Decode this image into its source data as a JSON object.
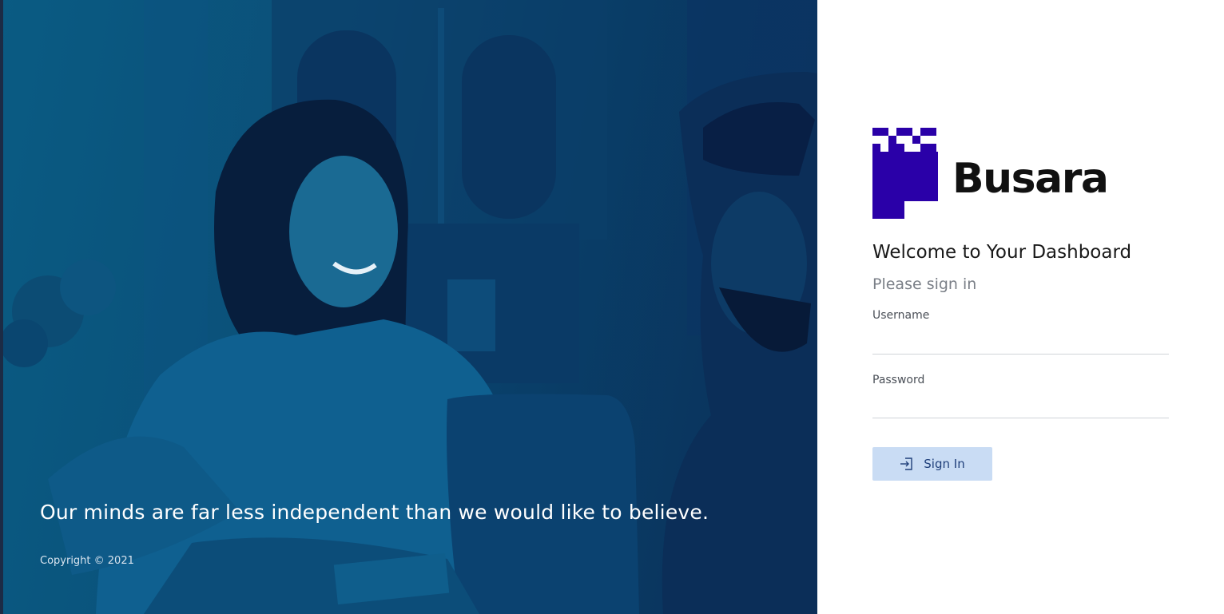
{
  "hero": {
    "quote": "Our minds are far less independent than we would like to believe.",
    "copyright": "Copyright © 2021",
    "image_description_icon": "photo-people-talking"
  },
  "brand": {
    "name": "Busara",
    "logo_color": "#2a00a8"
  },
  "login": {
    "title": "Welcome to Your Dashboard",
    "subtitle": "Please sign in",
    "username_label": "Username",
    "username_value": "",
    "password_label": "Password",
    "password_value": "",
    "submit_label": "Sign In",
    "submit_icon": "sign-in-icon"
  },
  "colors": {
    "hero_overlay": "#0a4f7a",
    "button_bg": "#c9dcf4",
    "button_text": "#1f3f7a",
    "brand_purple": "#2a00a8"
  }
}
